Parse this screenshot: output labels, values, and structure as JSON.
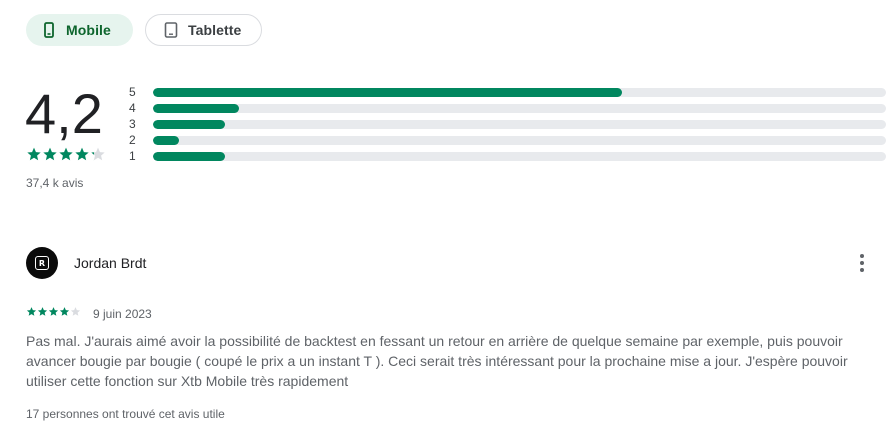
{
  "device_tabs": [
    {
      "label": "Mobile",
      "icon": "phone-icon",
      "selected": true
    },
    {
      "label": "Tablette",
      "icon": "tablet-icon",
      "selected": false
    }
  ],
  "rating": {
    "score": "4,2",
    "stars": 4.2,
    "total_label": "37,4 k avis",
    "histogram": [
      {
        "label": "5",
        "fraction": 0.64
      },
      {
        "label": "4",
        "fraction": 0.117
      },
      {
        "label": "3",
        "fraction": 0.098
      },
      {
        "label": "2",
        "fraction": 0.036
      },
      {
        "label": "1",
        "fraction": 0.098
      }
    ]
  },
  "review": {
    "author": "Jordan Brdt",
    "avatar_text": "R",
    "stars": 4,
    "date": "9 juin 2023",
    "text": "Pas mal. J'aurais aimé avoir la possibilité de backtest en fessant un retour en arrière de quelque semaine par exemple, puis pouvoir avancer bougie par bougie ( coupé le prix a un instant T ). Ceci serait très intéressant pour la prochaine mise a jour. J'espère pouvoir utiliser cette fonction sur Xtb Mobile très rapidement",
    "helpful": "17 personnes ont trouvé cet avis utile"
  },
  "colors": {
    "accent": "#01875f",
    "track": "#e8eaed",
    "star_empty": "#dadce0"
  }
}
